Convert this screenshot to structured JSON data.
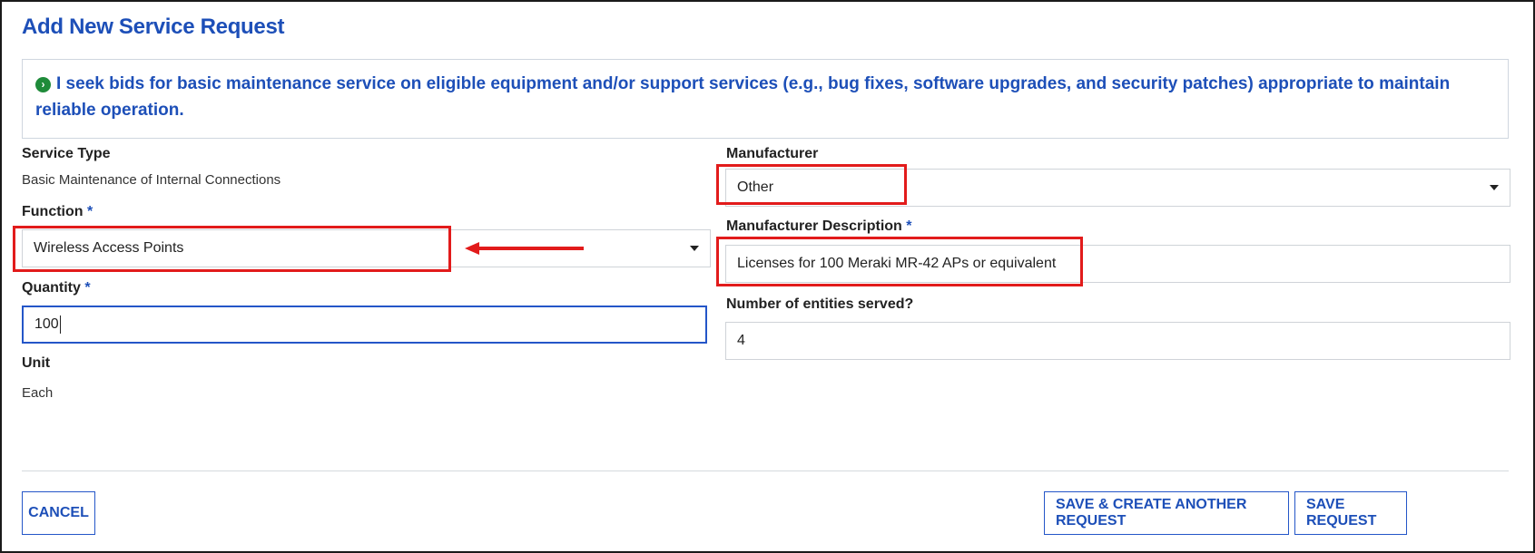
{
  "page": {
    "title": "Add New Service Request",
    "notice": "I seek bids for basic maintenance service on eligible equipment and/or support services (e.g., bug fixes, software upgrades, and security patches) appropriate to maintain reliable operation.",
    "required_mark": "*"
  },
  "form": {
    "service_type": {
      "label": "Service Type",
      "value": "Basic Maintenance of Internal Connections"
    },
    "function": {
      "label": "Function",
      "value": "Wireless Access Points"
    },
    "quantity": {
      "label": "Quantity",
      "value": "100"
    },
    "unit": {
      "label": "Unit",
      "value": "Each"
    },
    "manufacturer": {
      "label": "Manufacturer",
      "value": "Other"
    },
    "manufacturer_description": {
      "label": "Manufacturer Description",
      "value": "Licenses for 100 Meraki MR-42 APs or equivalent"
    },
    "entities_served": {
      "label": "Number of entities served?",
      "value": "4"
    }
  },
  "actions": {
    "cancel": "CANCEL",
    "save_and_create": "SAVE & CREATE ANOTHER REQUEST",
    "save": "SAVE REQUEST"
  },
  "colors": {
    "accent": "#1d4fb8",
    "highlight": "#e21b1b",
    "notice_icon": "#1f8b3a"
  },
  "icons": {
    "notice": "chevron-right-circle-icon",
    "dropdown": "caret-down-icon",
    "annotation": "arrow-left-icon"
  }
}
